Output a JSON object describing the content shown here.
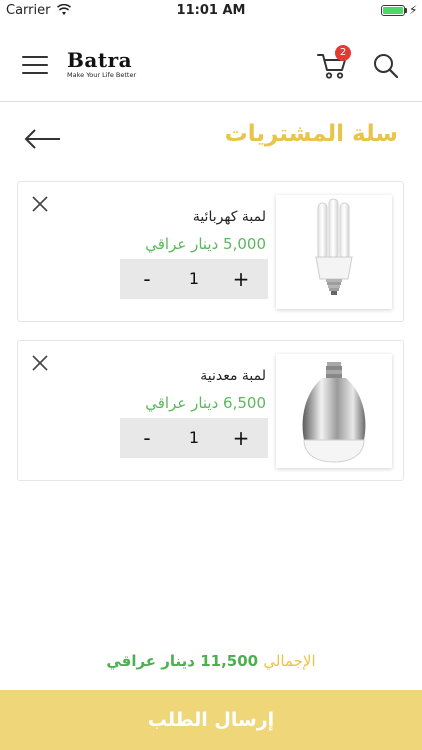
{
  "status_bar": {
    "carrier": "Carrier",
    "time": "11:01 AM"
  },
  "header": {
    "logo_title": "Batra",
    "logo_tagline": "Make Your Life Better",
    "cart_count": "2"
  },
  "page": {
    "title": "سلة المشتريات"
  },
  "cart_items": [
    {
      "name": "لمبة كهربائية",
      "price": "5,000 دينار عراقي",
      "quantity": "1",
      "image": "cfl-bulb"
    },
    {
      "name": "لمبة معدنية",
      "price": "6,500 دينار عراقي",
      "quantity": "1",
      "image": "led-bulb"
    }
  ],
  "stepper": {
    "minus": "-",
    "plus": "+"
  },
  "total": {
    "label": "الإجمالي",
    "value": "11,500 دينار عراقي"
  },
  "submit_label": "إرسال الطلب",
  "colors": {
    "accent": "#e8c54a",
    "price": "#5cb85c",
    "button": "#efd779",
    "badge": "#e53935"
  }
}
